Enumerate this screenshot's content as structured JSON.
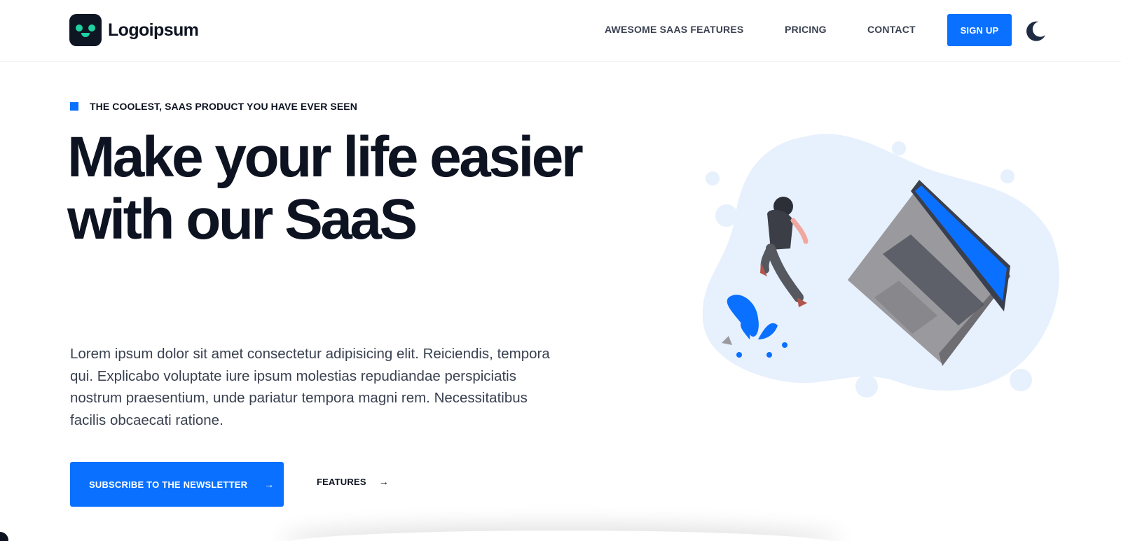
{
  "brand": {
    "name": "Logoipsum",
    "colors": {
      "accent": "#0a70ff",
      "dark": "#0d1321",
      "mint": "#1fd1a0",
      "blob": "#e7f0fd"
    }
  },
  "nav": {
    "items": [
      {
        "label": "AWESOME SAAS FEATURES"
      },
      {
        "label": "PRICING"
      },
      {
        "label": "CONTACT"
      }
    ],
    "signup_label": "SIGN UP",
    "theme_icon": "moon-icon"
  },
  "hero": {
    "eyebrow": "THE COOLEST, SAAS PRODUCT YOU HAVE EVER SEEN",
    "headline": "Make your life easier with our SaaS",
    "description": "Lorem ipsum dolor sit amet consectetur adipisicing elit. Reiciendis, tempora qui. Explicabo voluptate iure ipsum molestias repudiandae perspiciatis nostrum praesentium, unde pariatur tempora magni rem. Necessitatibus facilis obcaecati ratione.",
    "primary_cta": {
      "label": "SUBSCRIBE TO THE NEWSLETTER",
      "arrow": "→"
    },
    "secondary_cta": {
      "label": "FEATURES",
      "arrow": "→"
    }
  },
  "illustration": {
    "subject": "person-walking-to-laptop",
    "icons": [
      "person-figure",
      "laptop-icon",
      "plant-icon"
    ]
  }
}
